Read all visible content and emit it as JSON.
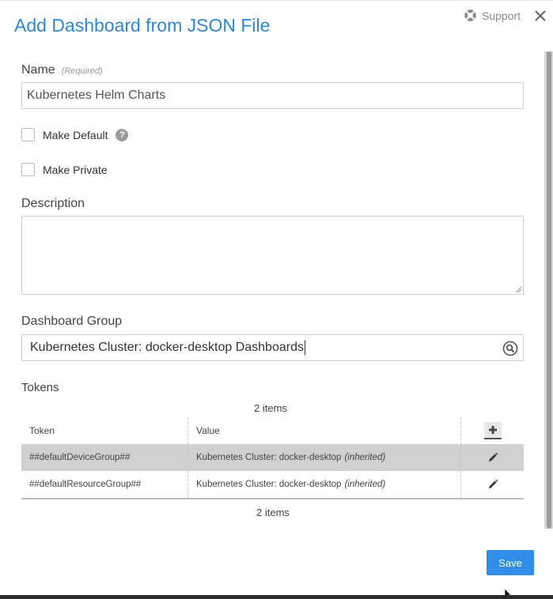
{
  "dialog": {
    "title": "Add Dashboard from JSON File",
    "support_label": "Support"
  },
  "form": {
    "name_label": "Name",
    "name_required": "(Required)",
    "name_value": "Kubernetes Helm Charts",
    "make_default_label": "Make Default",
    "make_default_checked": false,
    "help_glyph": "?",
    "make_private_label": "Make Private",
    "make_private_checked": false,
    "description_label": "Description",
    "description_value": "",
    "group_label": "Dashboard Group",
    "group_value": "Kubernetes Cluster: docker-desktop Dashboards"
  },
  "tokens": {
    "label": "Tokens",
    "count_top": "2 items",
    "count_bottom": "2 items",
    "columns": [
      "Token",
      "Value"
    ],
    "rows": [
      {
        "token": "##defaultDeviceGroup##",
        "value": "Kubernetes Cluster: docker-desktop",
        "note": "(inherited)",
        "selected": true
      },
      {
        "token": "##defaultResourceGroup##",
        "value": "Kubernetes Cluster: docker-desktop",
        "note": "(inherited)",
        "selected": false
      }
    ]
  },
  "actions": {
    "save_label": "Save"
  },
  "colors": {
    "title": "#2b88d8",
    "save": "#2f8fe8",
    "selected_row": "#d0d0d0"
  },
  "icons": [
    "lifebuoy-icon",
    "close-icon",
    "help-icon",
    "search-icon",
    "plus-icon",
    "pencil-icon",
    "cursor-icon"
  ]
}
